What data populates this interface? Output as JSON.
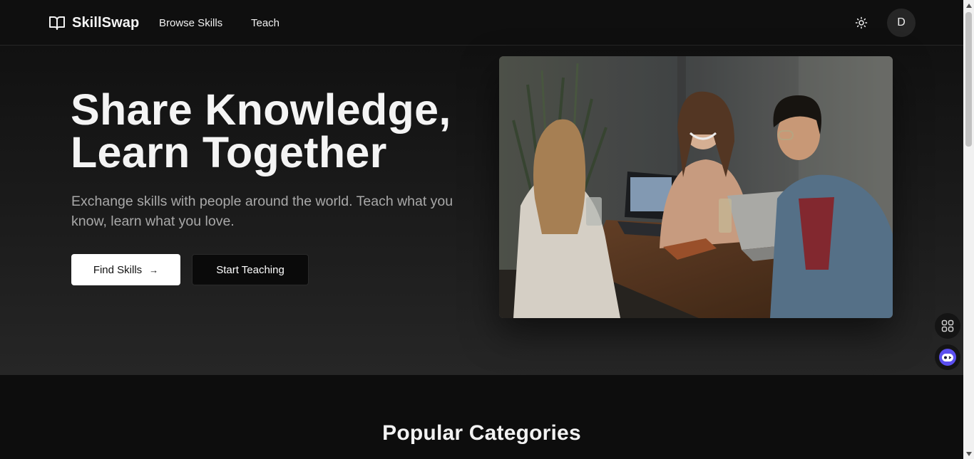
{
  "header": {
    "brand_name": "SkillSwap",
    "brand_icon": "open-book-icon",
    "nav": [
      {
        "label": "Browse Skills"
      },
      {
        "label": "Teach"
      }
    ],
    "theme_toggle_icon": "sun-icon",
    "avatar_initial": "D"
  },
  "hero": {
    "title_line1": "Share Knowledge,",
    "title_line2": "Learn Together",
    "subtitle": "Exchange skills with people around the world. Teach what you know, learn what you love.",
    "primary_button": {
      "label": "Find Skills",
      "arrow": "→"
    },
    "secondary_button": {
      "label": "Start Teaching"
    },
    "image": "photo-of-three-people-laughing-around-laptops-at-wooden-table"
  },
  "categories": {
    "title": "Popular Categories"
  },
  "floating": {
    "apps_icon": "grid-apps-icon",
    "assistant_icon": "robot-assistant-icon"
  },
  "colors": {
    "background": "#0d0d0d",
    "header": "#0f0f0f",
    "primary_button_bg": "#ffffff",
    "secondary_button_bg": "#0a0a0a",
    "assistant_accent": "#5b4ff0"
  }
}
